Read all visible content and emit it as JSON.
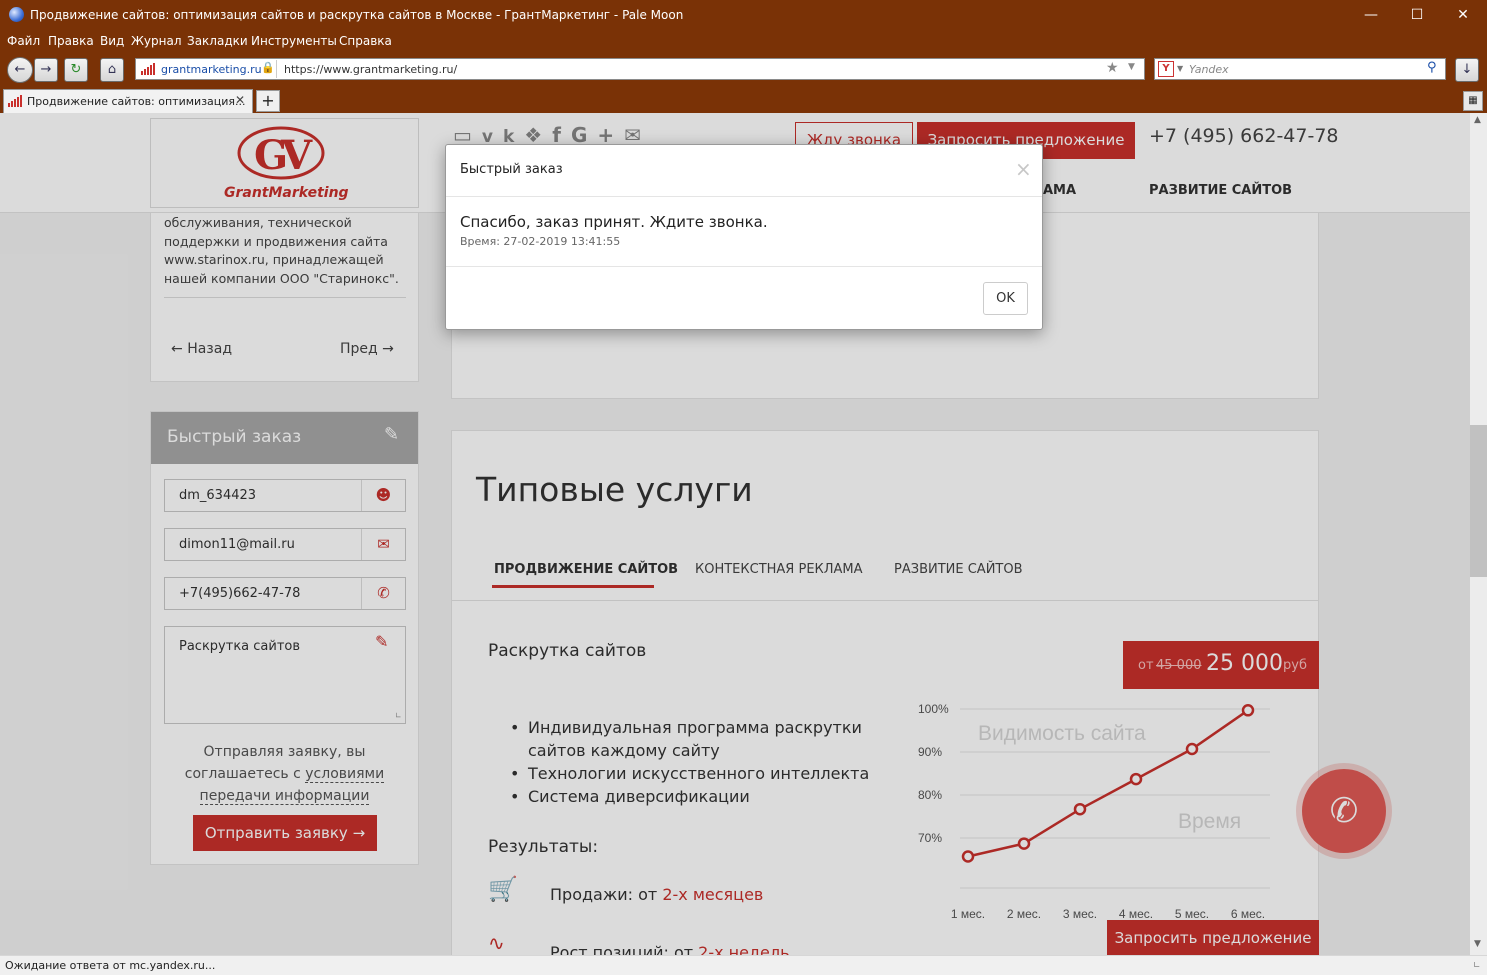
{
  "window": {
    "title": "Продвижение сайтов: оптимизация сайтов и раскрутка сайтов в Москве - ГрантМаркетинг - Pale Moon"
  },
  "menu": [
    "Файл",
    "Правка",
    "Вид",
    "Журнал",
    "Закладки",
    "Инструменты",
    "Справка"
  ],
  "toolbar": {
    "site_label": "grantmarketing.ru",
    "url": "https://www.grantmarketing.ru/",
    "search_placeholder": "Yandex"
  },
  "tab": {
    "title": "Продвижение сайтов: оптимизация..."
  },
  "status": "Ожидание ответа от mc.yandex.ru...",
  "header": {
    "logo_text": "GrantMarketing",
    "callback_label": "Жду звонка",
    "request_label": "Запросить предложение",
    "phone": "+7 (495) 662-47-78",
    "nav_partial": "АМА",
    "nav_develop": "РАЗВИТИЕ САЙТОВ"
  },
  "sidebar": {
    "project_text_lines": [
      "обслуживания, технической",
      "поддержки и продвижения сайта",
      "www.starinox.ru, принадлежащей",
      "нашей компании ООО \"Старинокс\"."
    ],
    "prev_label": "Назад",
    "next_label": "Пред"
  },
  "quick_order": {
    "title": "Быстрый заказ",
    "name_value": "dm_634423",
    "email_value": "dimon11@mail.ru",
    "phone_value": "+7(495)662-47-78",
    "message_value": "Раскрутка сайтов",
    "agree_line1": "Отправляя заявку, вы",
    "agree_line2_prefix": "соглашаетесь с ",
    "agree_link_part1": "условиями",
    "agree_link_part2": "передачи информации",
    "submit_label": "Отправить заявку"
  },
  "services": {
    "heading": "Типовые услуги",
    "tabs": [
      "ПРОДВИЖЕНИЕ САЙТОВ",
      "КОНТЕКСТНАЯ РЕКЛАМА",
      "РАЗВИТИЕ САЙТОВ"
    ],
    "active_tab": 0,
    "item_title": "Раскрутка сайтов",
    "price_prefix": "от",
    "old_price": "45 000",
    "new_price": "25 000",
    "currency": "руб",
    "bullets": [
      "Индивидуальная программа раскрутки",
      "сайтов каждому сайту",
      "Технологии искусственного интеллекта",
      "Система диверсификации"
    ],
    "results_label": "Результаты:",
    "result1_prefix": "Продажи: от ",
    "result1_link": "2-х месяцев",
    "result2_prefix": "Рост позиций: от ",
    "result2_link": "2-х недель",
    "request_button": "Запросить предложение"
  },
  "chart_data": {
    "type": "line",
    "title": "Видимость сайта",
    "xlabel": "Время",
    "x": [
      "1 мес.",
      "2 мес.",
      "3 мес.",
      "4 мес.",
      "5 мес.",
      "6 мес."
    ],
    "values": [
      65,
      68,
      76,
      83,
      90,
      99
    ],
    "ytick_labels": [
      "100%",
      "90%",
      "80%",
      "70%"
    ],
    "ylim": [
      60,
      100
    ],
    "color": "#c9302c",
    "grid": true
  },
  "modal": {
    "title": "Быстрый заказ",
    "close_symbol": "×",
    "message": "Спасибо, заказ принят. Ждите звонка.",
    "time_line": "Время: 27-02-2019 13:41:55",
    "ok_label": "OK"
  },
  "colors": {
    "brand_red": "#c9302c",
    "chrome_brown": "#7a3206"
  }
}
